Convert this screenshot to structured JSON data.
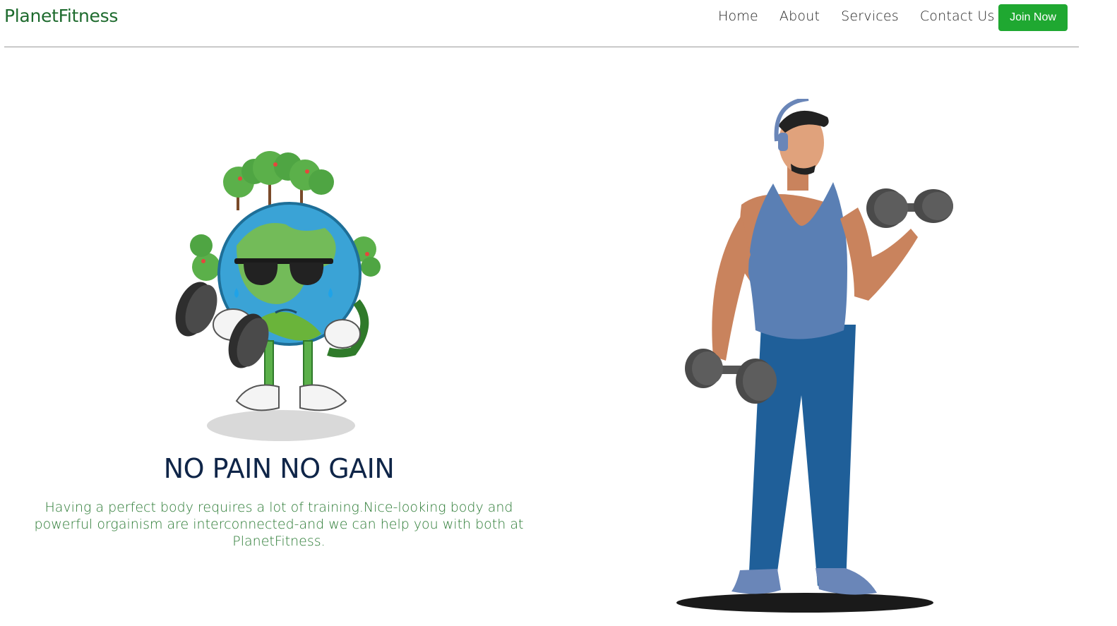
{
  "brand": {
    "name": "PlanetFitness",
    "color": "#1e6b2e"
  },
  "nav": {
    "links": [
      {
        "label": "Home"
      },
      {
        "label": "About"
      },
      {
        "label": "Services"
      },
      {
        "label": "Contact Us"
      }
    ],
    "join_label": "Join Now",
    "join_color": "#1fa831"
  },
  "hero": {
    "headline": "NO PAIN NO GAIN",
    "description": "Having a perfect body requires a lot of training.Nice-looking body and powerful orgainism are interconnected-and we can help you with both at PlanetFitness.",
    "headline_color": "#0f2548",
    "description_color": "#2a7a33"
  },
  "illustrations": {
    "left": "earth-mascot-with-dumbbells",
    "right": "man-lifting-dumbbells"
  }
}
